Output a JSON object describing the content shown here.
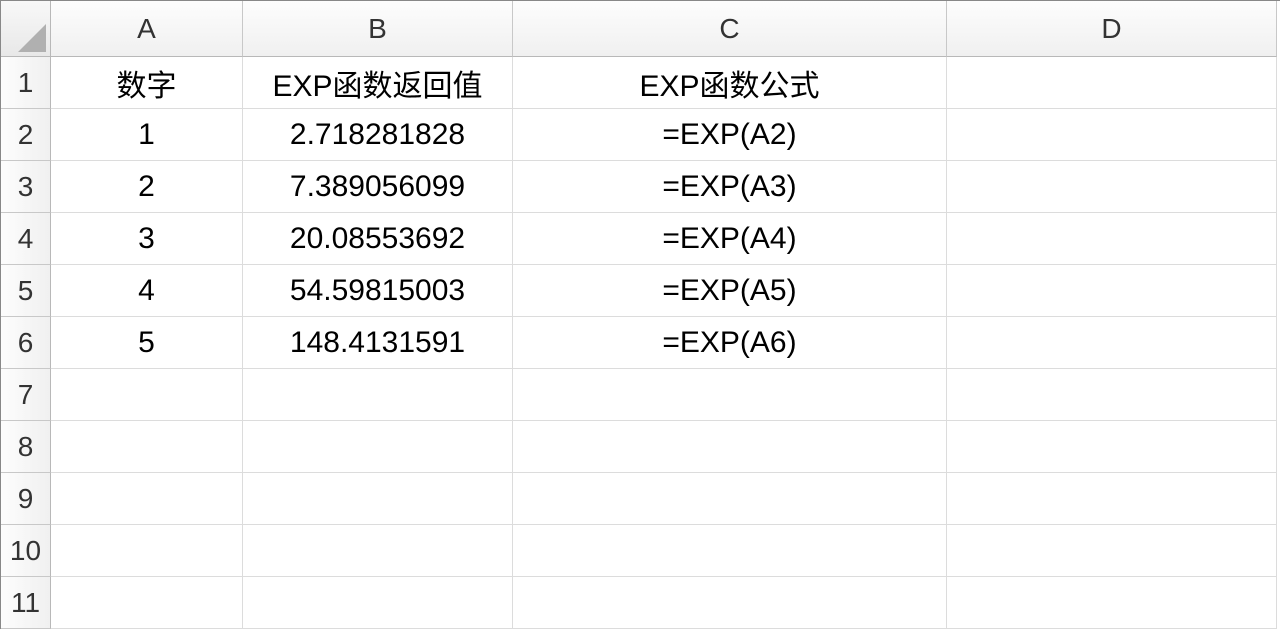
{
  "columns": [
    "A",
    "B",
    "C",
    "D"
  ],
  "rowNumbers": [
    "1",
    "2",
    "3",
    "4",
    "5",
    "6",
    "7",
    "8",
    "9",
    "10",
    "11"
  ],
  "grid": {
    "r1": {
      "A": "数字",
      "B": "EXP函数返回值",
      "C": "EXP函数公式",
      "D": ""
    },
    "r2": {
      "A": "1",
      "B": "2.718281828",
      "C": "=EXP(A2)",
      "D": ""
    },
    "r3": {
      "A": "2",
      "B": "7.389056099",
      "C": "=EXP(A3)",
      "D": ""
    },
    "r4": {
      "A": "3",
      "B": "20.08553692",
      "C": "=EXP(A4)",
      "D": ""
    },
    "r5": {
      "A": "4",
      "B": "54.59815003",
      "C": "=EXP(A5)",
      "D": ""
    },
    "r6": {
      "A": "5",
      "B": "148.4131591",
      "C": "=EXP(A6)",
      "D": ""
    },
    "r7": {
      "A": "",
      "B": "",
      "C": "",
      "D": ""
    },
    "r8": {
      "A": "",
      "B": "",
      "C": "",
      "D": ""
    },
    "r9": {
      "A": "",
      "B": "",
      "C": "",
      "D": ""
    },
    "r10": {
      "A": "",
      "B": "",
      "C": "",
      "D": ""
    },
    "r11": {
      "A": "",
      "B": "",
      "C": "",
      "D": ""
    }
  }
}
